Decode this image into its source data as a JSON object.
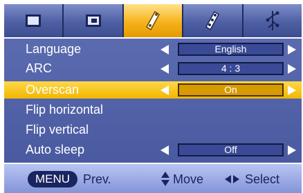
{
  "tabs": [
    {
      "icon": "picture-icon",
      "active": false
    },
    {
      "icon": "screen-icon",
      "active": false
    },
    {
      "icon": "option-icon",
      "active": true
    },
    {
      "icon": "setup-icon",
      "active": false
    },
    {
      "icon": "input-icon",
      "active": false
    }
  ],
  "menu": {
    "items": [
      {
        "label": "Language",
        "value": "English",
        "selected": false
      },
      {
        "label": "ARC",
        "value": "4 : 3",
        "selected": false
      },
      {
        "label": "Overscan",
        "value": "On",
        "selected": true
      },
      {
        "label": "Flip horizontal",
        "value": null,
        "selected": false
      },
      {
        "label": "Flip vertical",
        "value": null,
        "selected": false
      },
      {
        "label": "Auto sleep",
        "value": "Off",
        "selected": false
      }
    ]
  },
  "help": {
    "menu_key": "MENU",
    "prev": "Prev.",
    "move": "Move",
    "select": "Select"
  },
  "colors": {
    "menu_bg": "#5060a8",
    "selected_bg": "#f5c000",
    "help_bg": "#a3b2ea",
    "tab_active": "#f5b21c"
  }
}
